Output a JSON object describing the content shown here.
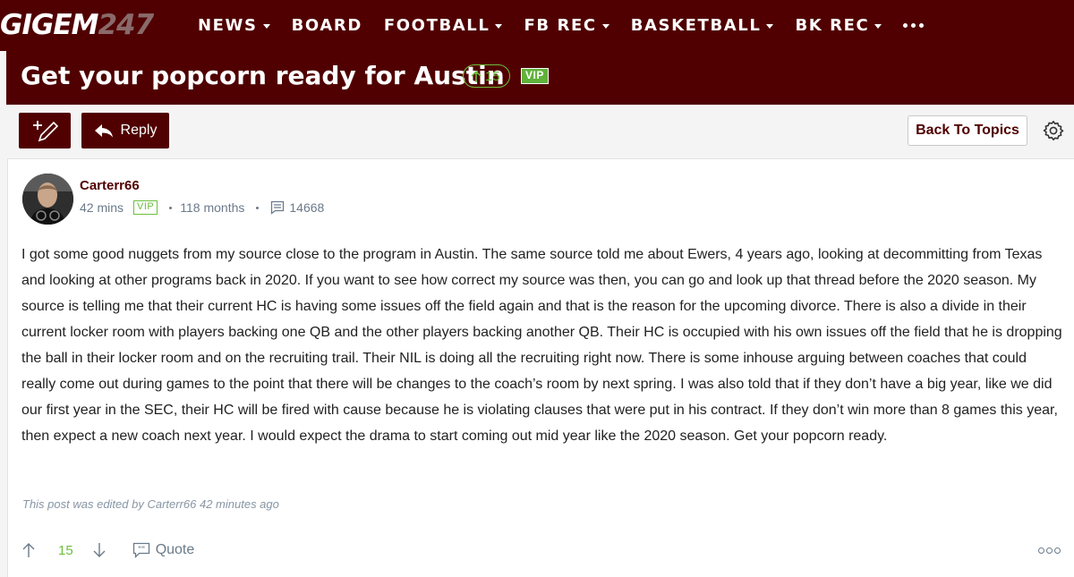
{
  "site": {
    "logo_main": "GIGEM",
    "logo_num": "247"
  },
  "nav": {
    "items": [
      {
        "label": "NEWS",
        "dropdown": true
      },
      {
        "label": "BOARD",
        "dropdown": false
      },
      {
        "label": "FOOTBALL",
        "dropdown": true
      },
      {
        "label": "FB REC",
        "dropdown": true
      },
      {
        "label": "BASKETBALL",
        "dropdown": true
      },
      {
        "label": "BK REC",
        "dropdown": true
      }
    ]
  },
  "thread": {
    "title": "Get your popcorn ready for Austin",
    "upvotes": "15",
    "vip_badge": "VIP"
  },
  "toolbar": {
    "reply_label": "Reply",
    "back_label": "Back To Topics"
  },
  "post": {
    "author": "Carterr66",
    "time": "42 mins",
    "vip_badge": "VIP",
    "tenure": "118 months",
    "post_count": "14668",
    "body": "I got some good nuggets from my source close to the program in Austin. The same source told me about Ewers, 4 years ago, looking at decommitting from Texas and looking at other programs back in 2020. If you want to see how correct my source was then, you can go and look up that thread before the 2020 season. My source is telling me that their current HC is having some issues off the field again and that is the reason for the upcoming divorce. There is also a divide in their current locker room with players backing one QB and the other players backing another QB. Their HC is occupied with his own issues off the field that he is dropping the ball in their locker room and on the recruiting trail. Their NIL is doing all the recruiting right now. There is some inhouse arguing between coaches that could really come out during games to the point that there will be changes to the coach’s room by next spring. I was also told that if they don’t have a big year, like we did our first year in the SEC, their HC will be fired with cause because he is violating clauses that were put in his contract. If they don’t win more than 8 games this year, then expect a new coach next year. I would expect the drama to start coming out mid year like the 2020 season. Get your popcorn ready.",
    "edited_note": "This post was edited by Carterr66 42 minutes ago",
    "vote_count": "15",
    "quote_label": "Quote"
  },
  "colors": {
    "brand_maroon": "#500000",
    "upvote_green": "#6cbf3c",
    "meta_gray": "#6b7a8a"
  },
  "icons": [
    "compose-icon",
    "reply-arrow-icon",
    "gear-icon",
    "upvote-arrow-icon",
    "downvote-arrow-icon",
    "posts-icon",
    "quote-icon",
    "more-options-icon",
    "more-nav-icon"
  ]
}
